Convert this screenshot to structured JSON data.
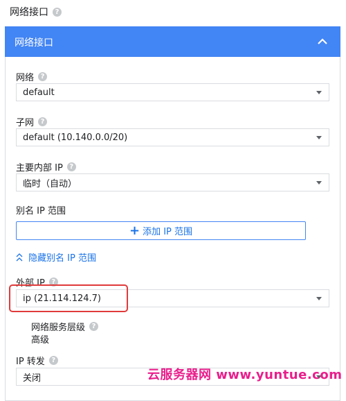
{
  "top_title": "网络接口",
  "panel": {
    "title": "网络接口"
  },
  "network": {
    "label": "网络",
    "value": "default"
  },
  "subnet": {
    "label": "子网",
    "value": "default (10.140.0.0/20)"
  },
  "primary_ip": {
    "label": "主要内部 IP",
    "value": "临时（自动）"
  },
  "alias": {
    "label": "别名 IP 范围",
    "add_button": "添加 IP 范围",
    "hide_link": "隐藏别名 IP 范围"
  },
  "external_ip": {
    "label": "外部 IP",
    "value": "ip (21.114.124.7)"
  },
  "network_tier": {
    "label": "网络服务层级",
    "value": "高级"
  },
  "ip_forwarding": {
    "label": "IP 转发",
    "value": "关闭"
  },
  "watermark": "云服务器网 www.yuntue.com",
  "colors": {
    "accent": "#4285f4",
    "highlight": "#e03a3a",
    "watermark": "#e91e8c"
  },
  "icons": [
    "help-icon",
    "chevron-up-icon",
    "caret-down-icon",
    "plus-icon",
    "double-chevron-up-icon"
  ]
}
